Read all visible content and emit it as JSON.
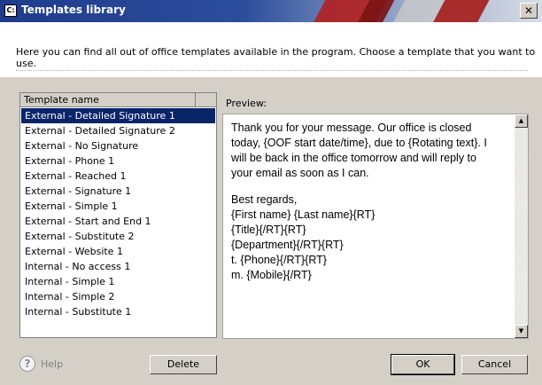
{
  "window": {
    "title": "Templates library",
    "app_icon_text": "C:",
    "close_glyph": "✕"
  },
  "header": {
    "intro": "Here you can find all out of office templates available in the program. Choose a template that you want to use."
  },
  "template_list": {
    "column_header": "Template name",
    "selected_index": 0,
    "items": [
      "External - Detailed Signature 1",
      "External - Detailed Signature 2",
      "External - No Signature",
      "External - Phone 1",
      "External - Reached 1",
      "External - Signature 1",
      "External - Simple 1",
      "External - Start and End 1",
      "External - Substitute 2",
      "External - Website 1",
      "Internal - No access 1",
      "Internal - Simple 1",
      "Internal - Simple 2",
      "Internal - Substitute 1"
    ]
  },
  "preview": {
    "label": "Preview:",
    "lines": [
      "Thank you for your message. Our office is closed",
      "today, {OOF start date/time}, due to {Rotating text}. I",
      "will be back in the office tomorrow and will reply to",
      "your email as soon as I can.",
      "",
      "Best regards,",
      "{First name} {Last name}{RT}",
      "{Title}{/RT}{RT}",
      "{Department}{/RT}{RT}",
      "t. {Phone}{/RT}{RT}",
      "m. {Mobile}{/RT}"
    ],
    "scroll_up_glyph": "▲",
    "scroll_down_glyph": "▼"
  },
  "footer": {
    "help_icon": "?",
    "help_label": "Help",
    "delete_label": "Delete",
    "ok_label": "OK",
    "cancel_label": "Cancel"
  },
  "colors": {
    "selection": "#0a246a",
    "dialog_background": "#d4d0c8",
    "titlebar": "#1e3c8c"
  }
}
